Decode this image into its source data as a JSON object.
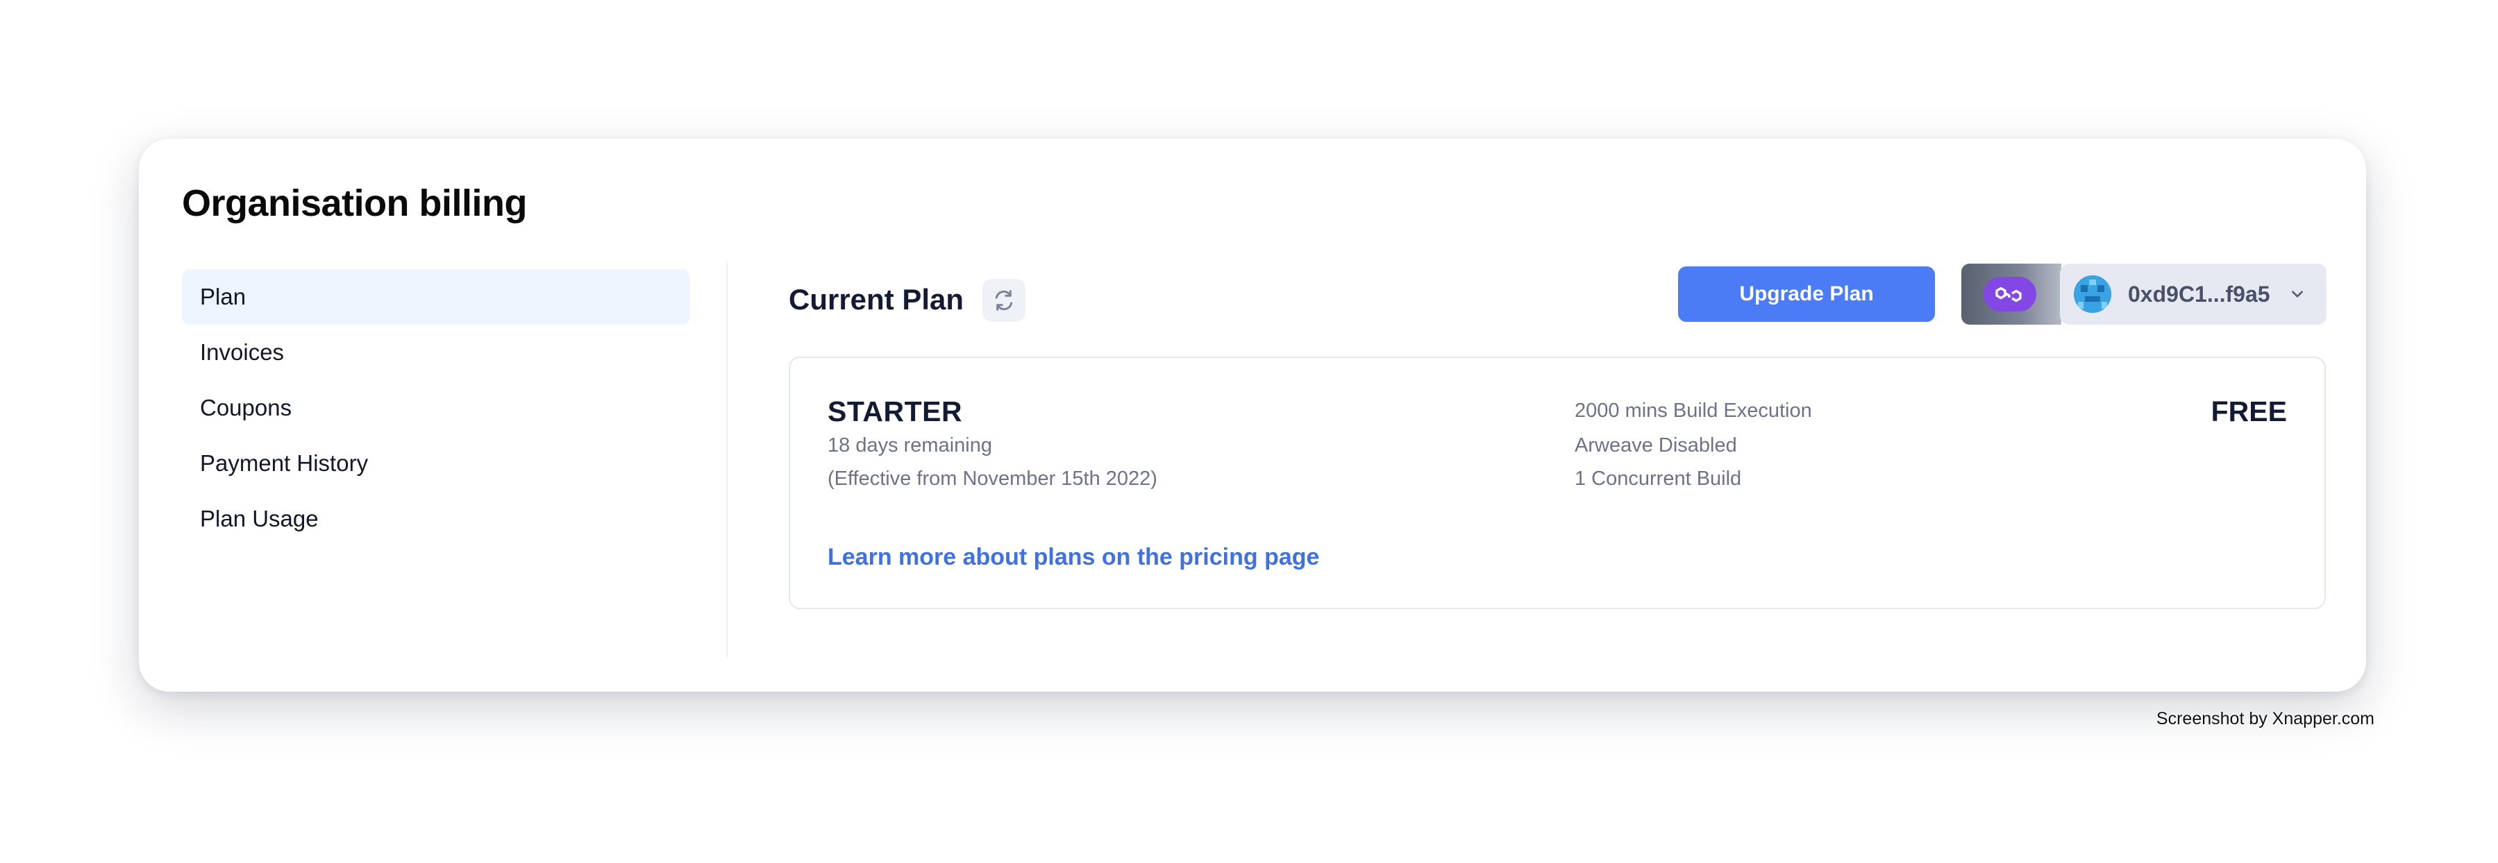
{
  "page": {
    "title": "Organisation billing"
  },
  "sidebar": {
    "items": [
      {
        "label": "Plan",
        "active": true
      },
      {
        "label": "Invoices"
      },
      {
        "label": "Coupons"
      },
      {
        "label": "Payment History"
      },
      {
        "label": "Plan Usage"
      }
    ]
  },
  "main": {
    "heading": "Current Plan",
    "refresh_icon": "refresh-icon",
    "upgrade_label": "Upgrade Plan",
    "wallet": {
      "network_icon": "polygon-icon",
      "address": "0xd9C1...f9a5",
      "chevron_icon": "chevron-down-icon"
    }
  },
  "plan": {
    "name": "STARTER",
    "remaining": "18 days remaining",
    "effective": "(Effective from November 15th 2022)",
    "features": [
      "2000 mins Build Execution",
      "Arweave Disabled",
      "1 Concurrent Build"
    ],
    "price": "FREE",
    "learn_more": "Learn more about plans on the pricing page"
  },
  "footer": {
    "credit": "Screenshot by Xnapper.com"
  },
  "colors": {
    "accent": "#4b7bf5",
    "link": "#3f72e0",
    "active_nav_bg": "#eff5fe",
    "polygon": "#8247e5",
    "heading": "#131a33",
    "muted": "#6b7388"
  }
}
